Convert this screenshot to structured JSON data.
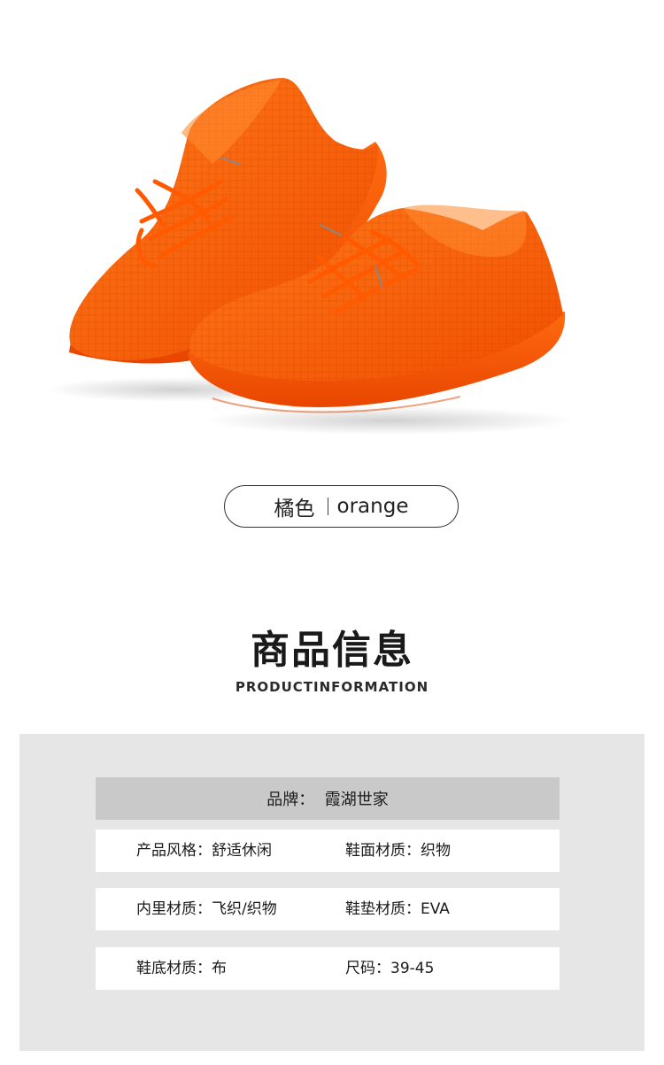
{
  "product": {
    "image_icon": "orange-knit-sneakers-photo",
    "shoe_color": "#ff5a06",
    "color_name_cn": "橘色",
    "color_name_en": "orange"
  },
  "section": {
    "title": "商品信息",
    "subtitle": "PRODUCTINFORMATION"
  },
  "info": {
    "brand": "品牌：  霞湖世家",
    "rows": [
      {
        "left": "产品风格：舒适休闲",
        "right": "鞋面材质：织物"
      },
      {
        "left": "内里材质：飞织/织物",
        "right": "鞋垫材质：EVA"
      },
      {
        "left": "鞋底材质：布",
        "right": "尺码：39-45"
      }
    ]
  }
}
